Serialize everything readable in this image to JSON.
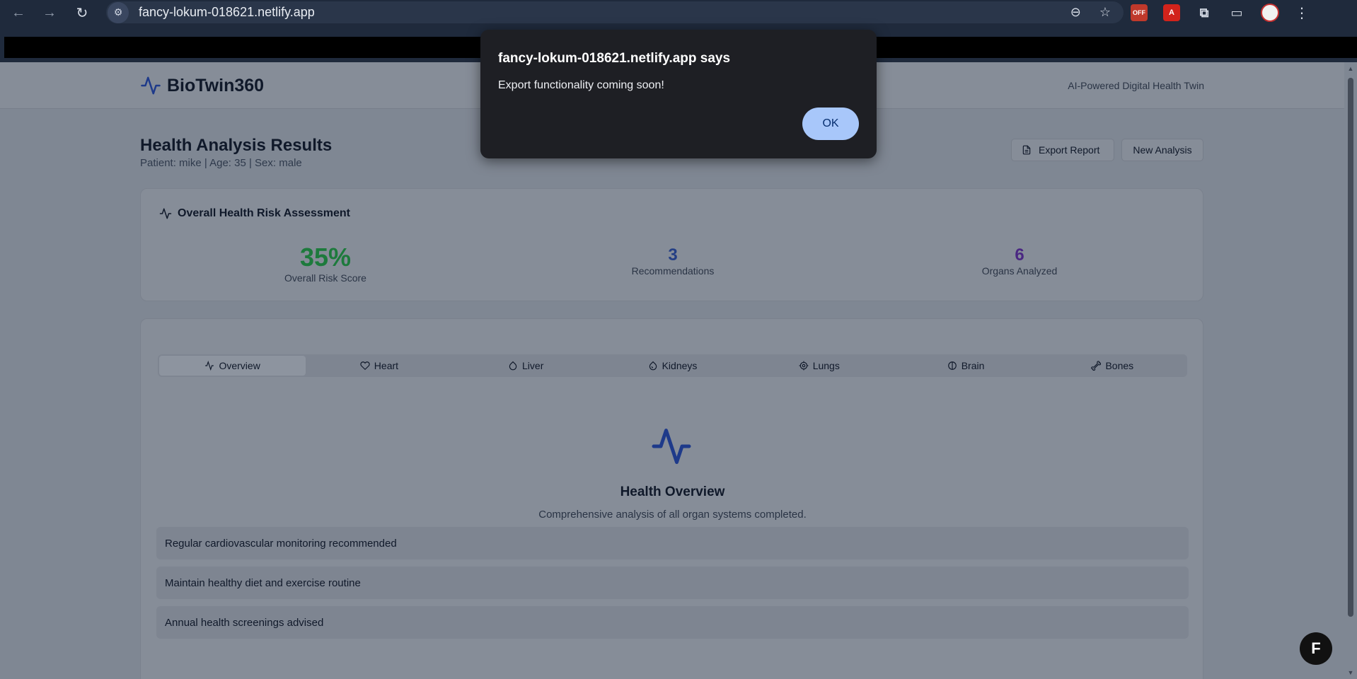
{
  "browser": {
    "url": "fancy-lokum-018621.netlify.app",
    "ext_off_label": "OFF"
  },
  "app": {
    "name": "BioTwin360",
    "tagline": "AI-Powered Digital Health Twin",
    "accent_color": "#1e3a8a"
  },
  "page": {
    "title": "Health Analysis Results",
    "patient_info": "Patient: mike | Age: 35 | Sex: male",
    "export_button": "Export Report",
    "new_button": "New Analysis"
  },
  "risk": {
    "title": "Overall Health Risk Assessment",
    "score": "35%",
    "score_label": "Overall Risk Score",
    "recommendations": "3",
    "recommendations_label": "Recommendations",
    "organs": "6",
    "organs_label": "Organs Analyzed"
  },
  "tabs": [
    {
      "label": "Overview",
      "icon": "activity-icon"
    },
    {
      "label": "Heart",
      "icon": "heart-icon"
    },
    {
      "label": "Liver",
      "icon": "droplet-icon"
    },
    {
      "label": "Kidneys",
      "icon": "kidney-icon"
    },
    {
      "label": "Lungs",
      "icon": "gear-icon"
    },
    {
      "label": "Brain",
      "icon": "brain-icon"
    },
    {
      "label": "Bones",
      "icon": "bone-icon"
    }
  ],
  "overview": {
    "title": "Health Overview",
    "description": "Comprehensive analysis of all organ systems completed.",
    "recommendations": [
      "Regular cardiovascular monitoring recommended",
      "Maintain healthy diet and exercise routine",
      "Annual health screenings advised"
    ]
  },
  "dialog": {
    "title": "fancy-lokum-018621.netlify.app says",
    "message": "Export functionality coming soon!",
    "ok": "OK"
  },
  "fab_label": "F"
}
